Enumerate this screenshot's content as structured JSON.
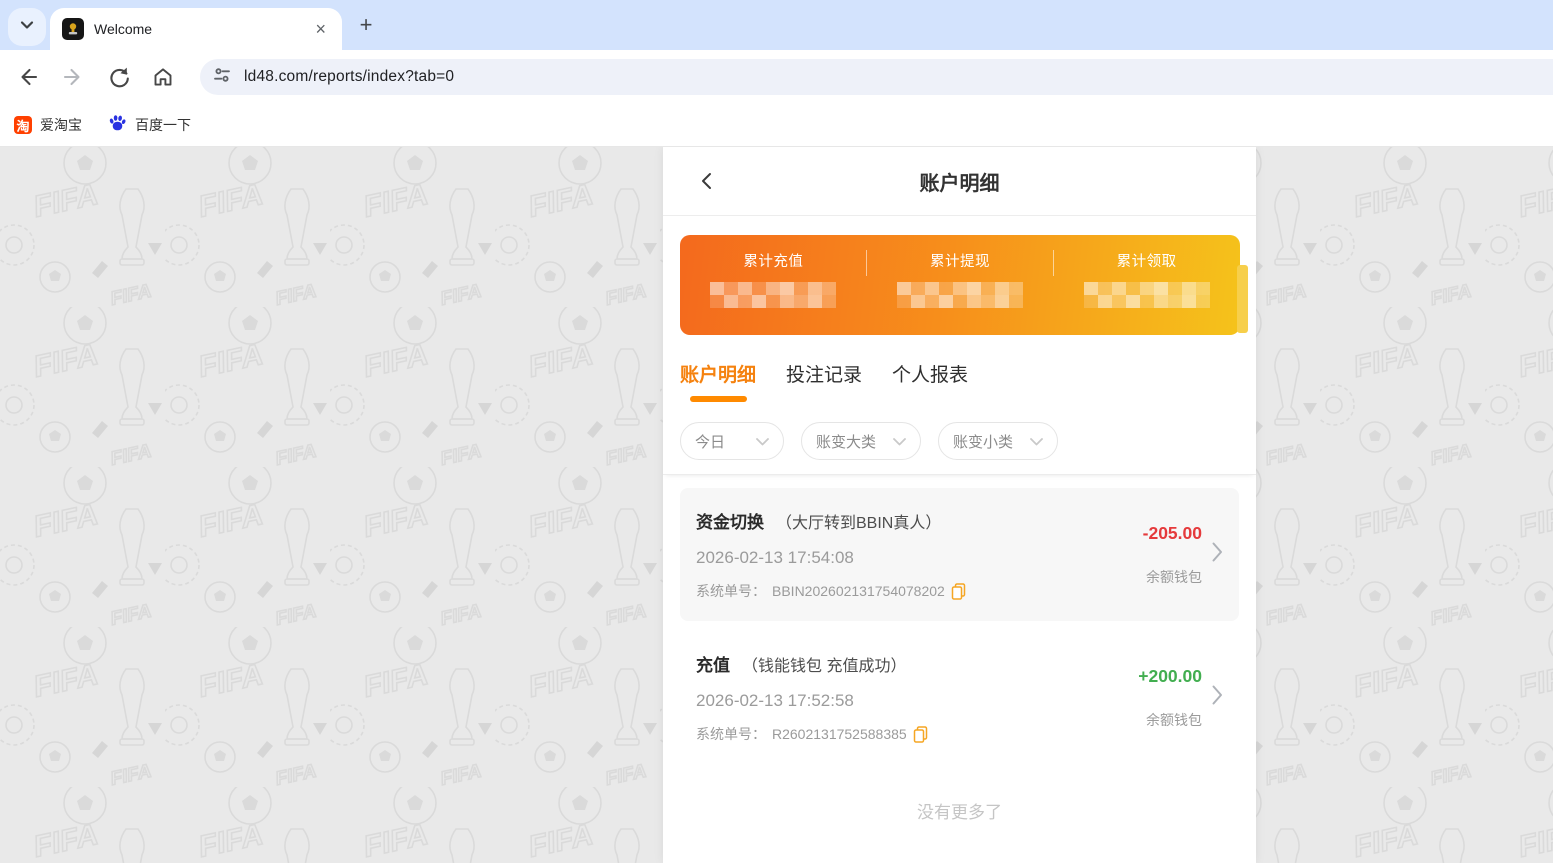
{
  "browser": {
    "tab_title": "Welcome",
    "url": "ld48.com/reports/index?tab=0",
    "bookmarks": [
      {
        "label": "爱淘宝",
        "icon": "taobao-icon"
      },
      {
        "label": "百度一下",
        "icon": "baidu-paw-icon"
      }
    ]
  },
  "page": {
    "title": "账户明细",
    "summary": {
      "labels": [
        "累计充值",
        "累计提现",
        "累计领取"
      ],
      "values_redacted": true,
      "gradient_start": "#f4691d",
      "gradient_end": "#f5c31b"
    },
    "tabs": [
      {
        "label": "账户明细",
        "active": true
      },
      {
        "label": "投注记录",
        "active": false
      },
      {
        "label": "个人报表",
        "active": false
      }
    ],
    "filters": [
      "今日",
      "账变大类",
      "账变小类"
    ],
    "transactions": [
      {
        "type": "资金切换",
        "note": "（大厅转到BBIN真人）",
        "datetime": "2026-02-13 17:54:08",
        "order_label": "系统单号：",
        "order_no": "BBIN202602131754078202",
        "amount": "-205.00",
        "amount_color": "#e53a3c",
        "wallet": "余额钱包"
      },
      {
        "type": "充值",
        "note": "（钱能钱包 充值成功）",
        "datetime": "2026-02-13 17:52:58",
        "order_label": "系统单号：",
        "order_no": "R2602131752588385",
        "amount": "+200.00",
        "amount_color": "#42ae50",
        "wallet": "余额钱包"
      }
    ],
    "end_text": "没有更多了",
    "colors": {
      "accent_tab": "#f5820f",
      "tab_underline": "#ff8a00",
      "copy_icon": "#f5a623"
    }
  }
}
